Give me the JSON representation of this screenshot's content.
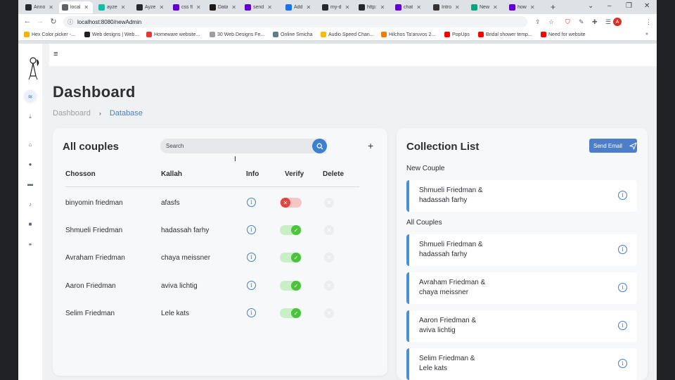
{
  "browser": {
    "tabs": [
      {
        "title": "Anno",
        "icon": "github-icon",
        "color": "#24292e"
      },
      {
        "title": "local",
        "icon": "globe-icon",
        "color": "#5f6368",
        "active": true
      },
      {
        "title": "ayze",
        "icon": "netlify-icon",
        "color": "#15bba6"
      },
      {
        "title": "Ayze",
        "icon": "github-icon",
        "color": "#24292e"
      },
      {
        "title": "css fl",
        "icon": "yahoo-icon",
        "color": "#6001d2"
      },
      {
        "title": "Data",
        "icon": "mongodb-icon",
        "color": "#1a1a1a"
      },
      {
        "title": "send",
        "icon": "yahoo-icon",
        "color": "#6001d2"
      },
      {
        "title": "Add",
        "icon": "mail-icon",
        "color": "#1a73e8"
      },
      {
        "title": "my-d",
        "icon": "github-icon",
        "color": "#24292e"
      },
      {
        "title": "http:",
        "icon": "github-icon",
        "color": "#24292e"
      },
      {
        "title": "chat",
        "icon": "yahoo-icon",
        "color": "#6001d2"
      },
      {
        "title": "Intro",
        "icon": "dev-icon",
        "color": "#333333"
      },
      {
        "title": "New",
        "icon": "chatgpt-icon",
        "color": "#10a37f"
      },
      {
        "title": "how",
        "icon": "yahoo-icon",
        "color": "#6001d2"
      }
    ],
    "url": "localhost:8080/newAdmin",
    "profile_initial": "A",
    "bookmarks": [
      {
        "label": "Hex Color picker -...",
        "color": "#f4b400"
      },
      {
        "label": "Web designs | Web...",
        "color": "#222222"
      },
      {
        "label": "Homeware website...",
        "color": "#e53935"
      },
      {
        "label": "30 Web Designs Fe...",
        "color": "#9e9e9e"
      },
      {
        "label": "Online Smicha",
        "color": "#607d8b"
      },
      {
        "label": "Audio Speed Chan...",
        "color": "#fbbc05"
      },
      {
        "label": "Hilchos Ta'aruvos 2...",
        "color": "#f57c00"
      },
      {
        "label": "PopUps",
        "color": "#ff0000"
      },
      {
        "label": "Bridal shower temp...",
        "color": "#ff0000"
      },
      {
        "label": "Need for website",
        "color": "#ff0000"
      }
    ],
    "more_bookmarks": "»"
  },
  "sidebar": {
    "items": [
      {
        "name": "database-icon",
        "glyph": "≋",
        "active": true
      },
      {
        "name": "download-icon",
        "glyph": "⤓"
      },
      {
        "name": "home-icon",
        "glyph": "⌂"
      },
      {
        "name": "info-circle-icon",
        "glyph": "●"
      },
      {
        "name": "message-icon",
        "glyph": "▬"
      },
      {
        "name": "bell-icon",
        "glyph": "♪"
      },
      {
        "name": "briefcase-icon",
        "glyph": "■"
      },
      {
        "name": "couple-icon",
        "glyph": "⚭"
      }
    ]
  },
  "header": {
    "menu_glyph": "≡",
    "title": "Dashboard",
    "breadcrumb": [
      "Dashboard",
      "Database"
    ],
    "breadcrumb_sep": "›"
  },
  "couples_card": {
    "title": "All couples",
    "search_placeholder": "Search",
    "add_glyph": "+",
    "columns": [
      "Chosson",
      "Kallah",
      "Info",
      "Verify",
      "Delete"
    ],
    "rows": [
      {
        "chosson": "binyomin friedman",
        "kallah": "afasfs",
        "verified": false
      },
      {
        "chosson": "Shmueli Friedman",
        "kallah": "hadassah farhy",
        "verified": true
      },
      {
        "chosson": "Avraham Friedman",
        "kallah": "chaya meissner",
        "verified": true
      },
      {
        "chosson": "Aaron Friedman",
        "kallah": "aviva lichtig",
        "verified": true
      },
      {
        "chosson": "Selim Friedman",
        "kallah": "Lele kats",
        "verified": true
      }
    ]
  },
  "collection_card": {
    "title": "Collection List",
    "send_email_label": "Send Email",
    "new_couple_label": "New Couple",
    "new_couples": [
      {
        "line1": "Shmueli Friedman &",
        "line2": "hadassah farhy"
      }
    ],
    "all_couples_label": "All Couples",
    "all_couples": [
      {
        "line1": "Shmueli Friedman &",
        "line2": "hadassah farhy"
      },
      {
        "line1": "Avraham Friedman &",
        "line2": "chaya meissner"
      },
      {
        "line1": "Aaron Friedman &",
        "line2": "aviva lichtig"
      },
      {
        "line1": "Selim Friedman &",
        "line2": "Lele kats"
      }
    ]
  },
  "colors": {
    "accent": "#3d7fd1",
    "verified_on": "#4cc33a",
    "verified_off": "#e2433a"
  }
}
